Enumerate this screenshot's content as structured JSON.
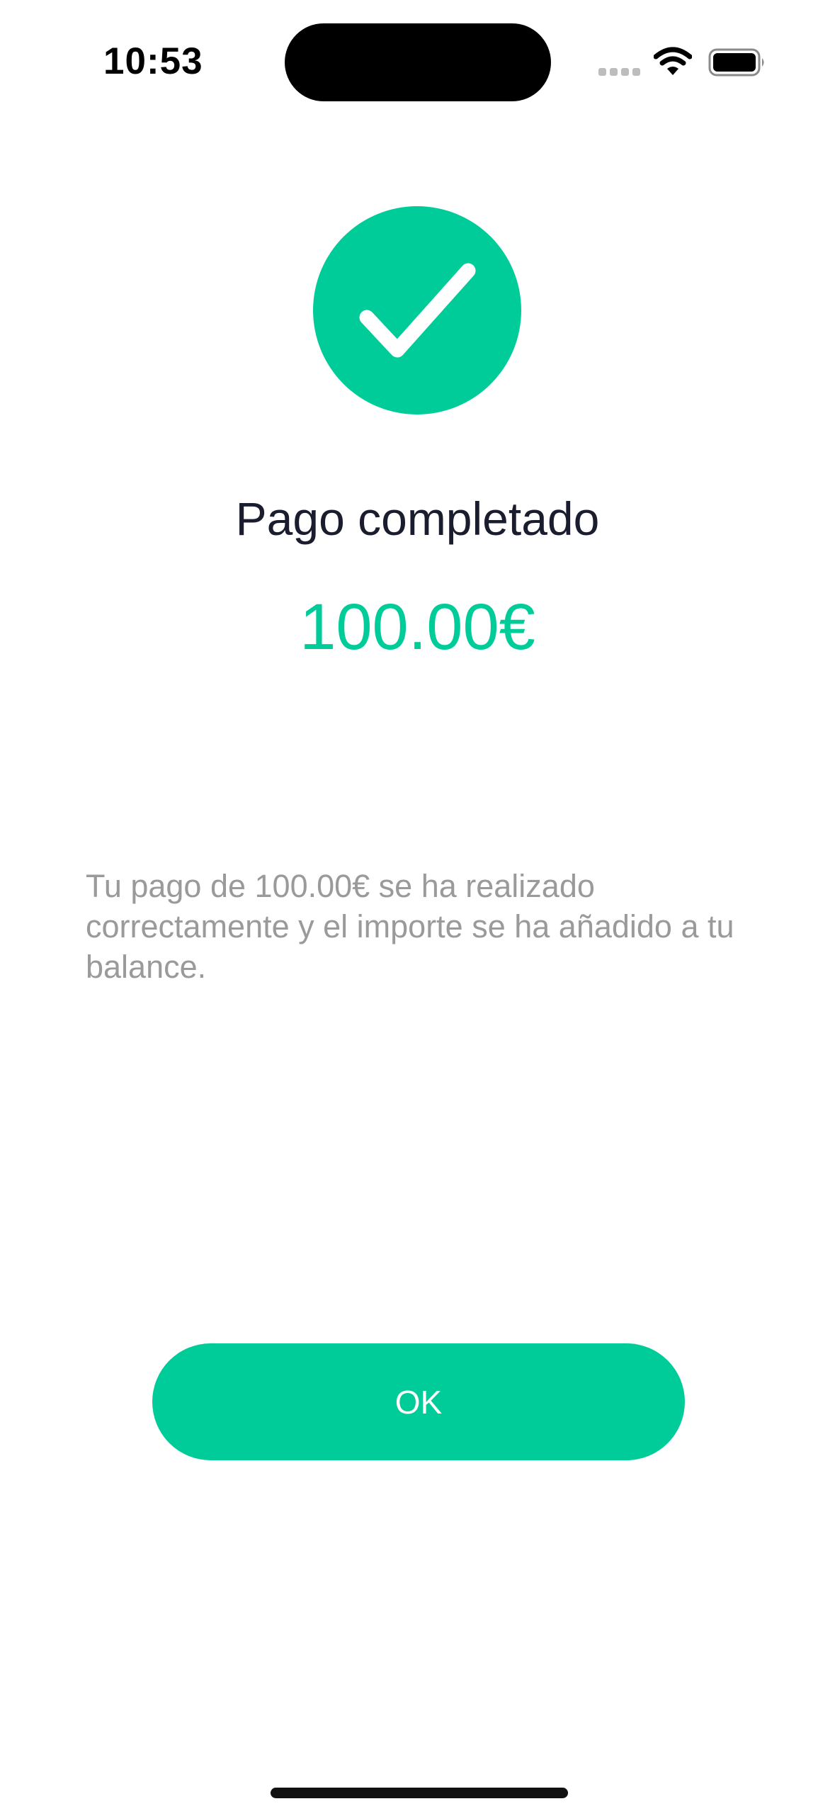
{
  "status_bar": {
    "time": "10:53",
    "icons": [
      "cellular-signal-icon",
      "wifi-icon",
      "battery-icon"
    ]
  },
  "success": {
    "icon": "checkmark-icon",
    "title": "Pago completado",
    "amount": "100.00€",
    "message": "Tu pago de 100.00€ se ha realizado correctamente y el importe se ha añadido a tu balance."
  },
  "actions": {
    "ok_label": "OK"
  },
  "colors": {
    "accent": "#00cc99",
    "title_text": "#1a1d2e",
    "message_text": "#9a9a9a",
    "background": "#ffffff"
  }
}
